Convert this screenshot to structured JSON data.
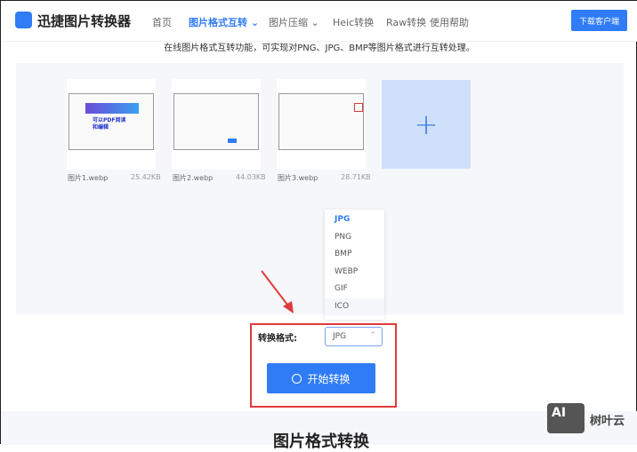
{
  "header": {
    "title": "迅捷图片转换器",
    "nav": [
      "首页",
      "图片格式互转",
      "图片压缩",
      "Heic转换",
      "Raw转换",
      "使用帮助"
    ],
    "download": "下载客户端"
  },
  "subtitle": "在线图片格式互转功能，可实现对PNG、JPG、BMP等图片格式进行互转处理。",
  "files": [
    {
      "name": "图片1.webp",
      "size": "25.42KB"
    },
    {
      "name": "图片2.webp",
      "size": "44.03KB"
    },
    {
      "name": "图片3.webp",
      "size": "28.71KB"
    }
  ],
  "thumb1_text": "可以PDF阅读和编辑",
  "add_label": "+",
  "dropdown": {
    "options": [
      "JPG",
      "PNG",
      "BMP",
      "WEBP",
      "GIF",
      "ICO"
    ]
  },
  "format": {
    "label": "转换格式:",
    "value": "JPG"
  },
  "start": "开始转换",
  "section_title": "图片格式转换",
  "watermark": {
    "logo": "AI",
    "text": "树叶云"
  },
  "colors": {
    "accent": "#2f7cf6",
    "annotation": "#e03b3b"
  }
}
